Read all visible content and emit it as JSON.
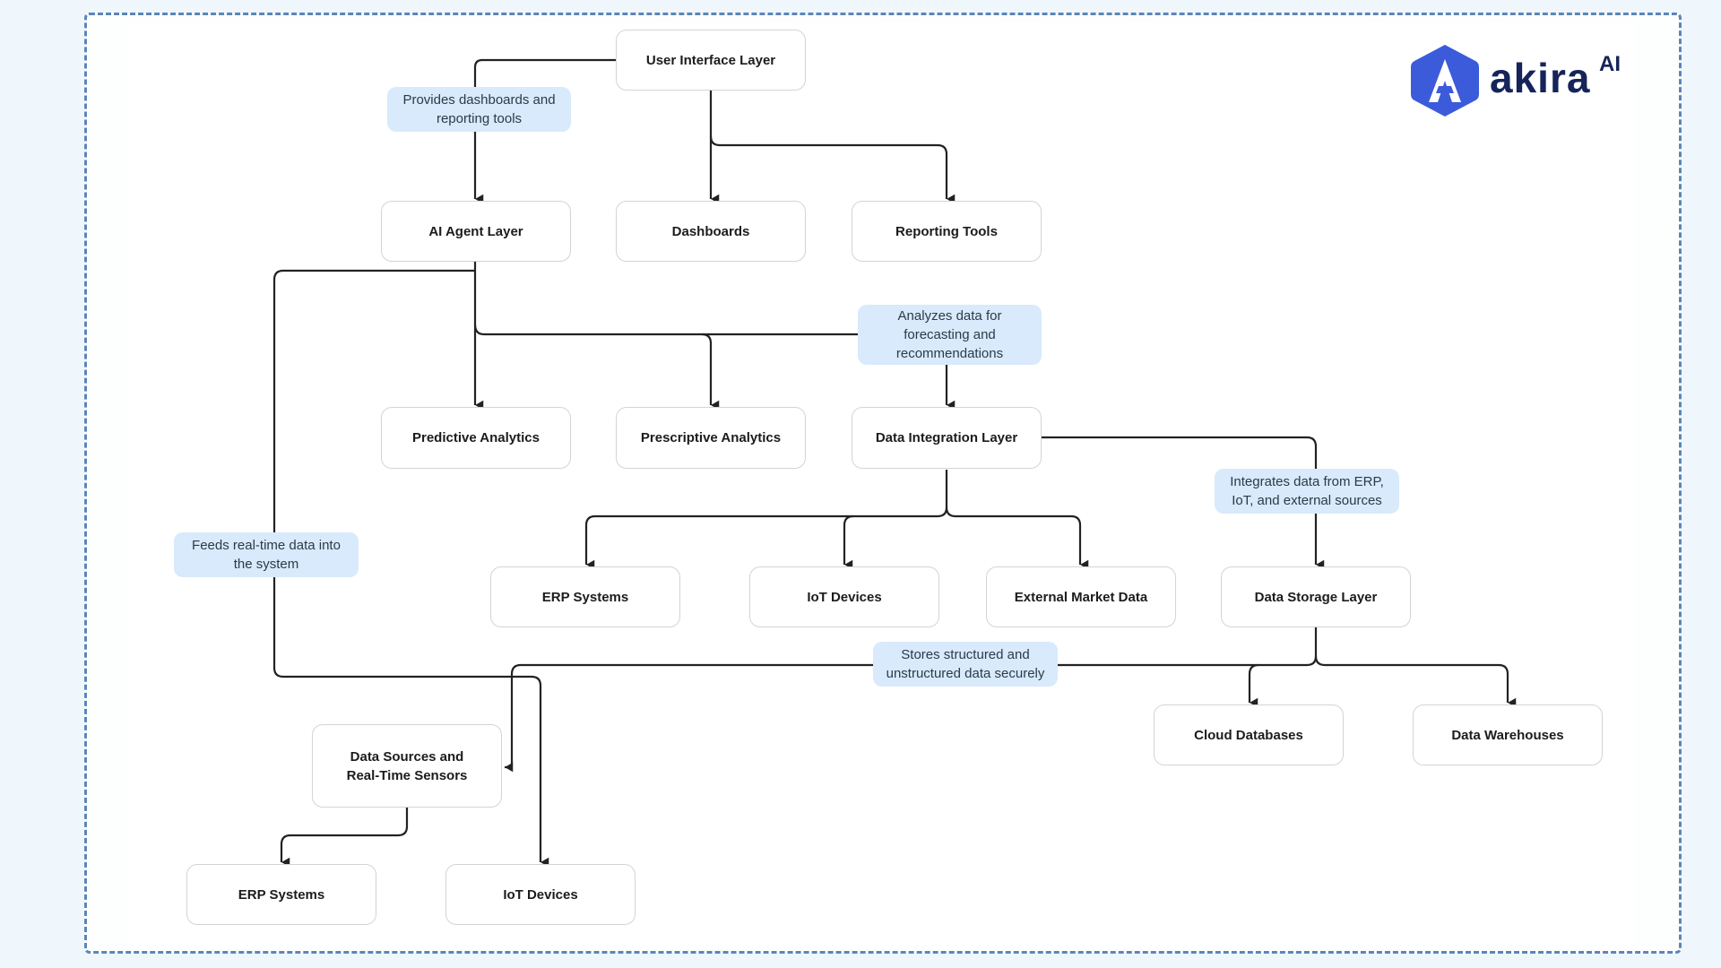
{
  "logo": {
    "wordmark": "akira",
    "superscript": "AI",
    "brand_color": "#3b5bdb",
    "text_color": "#16245a"
  },
  "nodes": {
    "ui_layer": "User Interface Layer",
    "ai_agent_layer": "AI Agent Layer",
    "dashboards": "Dashboards",
    "reporting_tools": "Reporting Tools",
    "predictive_analytics": "Predictive Analytics",
    "prescriptive_analytics": "Prescriptive Analytics",
    "data_integration_layer": "Data Integration Layer",
    "erp_systems": "ERP Systems",
    "iot_devices": "IoT Devices",
    "external_market_data": "External Market Data",
    "data_storage_layer": "Data Storage Layer",
    "cloud_databases": "Cloud Databases",
    "data_warehouses": "Data Warehouses",
    "data_sources_line1": "Data Sources and",
    "data_sources_line2": "Real-Time Sensors",
    "erp_systems_2": "ERP Systems",
    "iot_devices_2": "IoT Devices"
  },
  "notes": {
    "provides": [
      "Provides dashboards and",
      "reporting tools"
    ],
    "analyzes": [
      "Analyzes data for",
      "forecasting and",
      "recommendations"
    ],
    "integrates": [
      "Integrates data from ERP,",
      "IoT, and external sources"
    ],
    "feeds": [
      "Feeds real-time data into",
      "the system"
    ],
    "stores": [
      "Stores structured and",
      "unstructured data securely"
    ]
  },
  "colors": {
    "frame_border": "#5b86b8",
    "note_bg": "#d8eafb",
    "background": "#eff6fc",
    "line": "#222222"
  }
}
